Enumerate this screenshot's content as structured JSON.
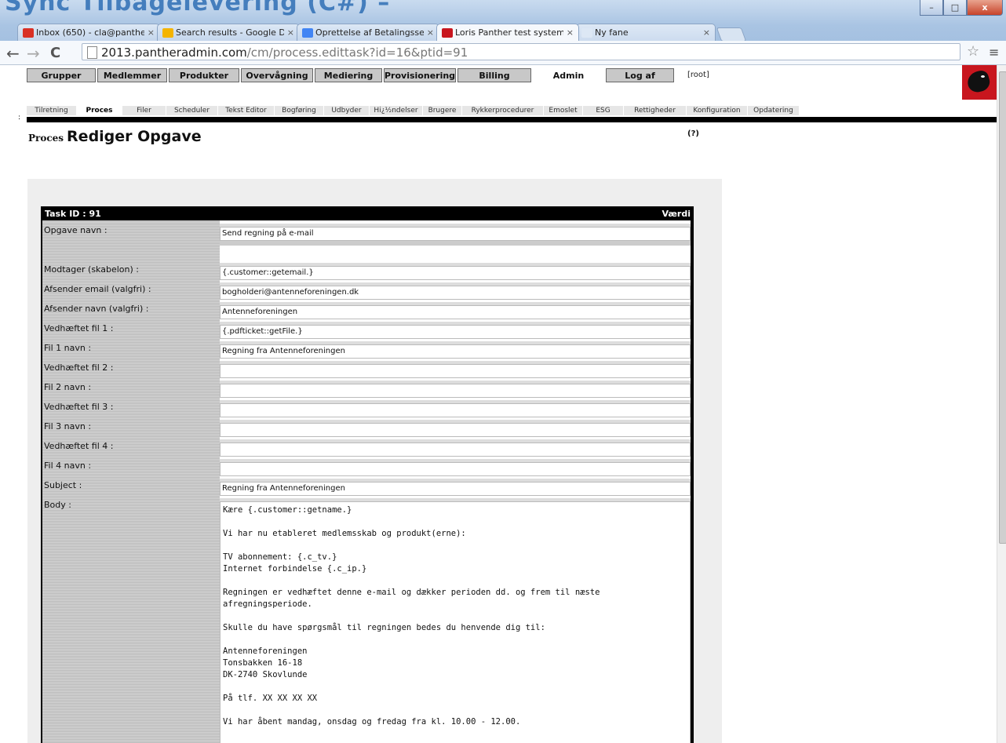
{
  "window": {
    "bg_title": "Sync Tilbagelevering (C#) –",
    "minimize": "–",
    "maximize": "□",
    "close": "x"
  },
  "tabs": [
    {
      "title": "Inbox (650) - cla@panther",
      "icon": "gmail-icon",
      "icon_color": "#d93025"
    },
    {
      "title": "Search results - Google Dr",
      "icon": "google-drive-icon",
      "icon_color": "#f4b400"
    },
    {
      "title": "Oprettelse af Betalingsser",
      "icon": "google-docs-icon",
      "icon_color": "#4285f4"
    },
    {
      "title": "Loris Panther test system",
      "icon": "panther-icon",
      "icon_color": "#c8161e"
    },
    {
      "title": "Ny fane",
      "icon": "",
      "icon_color": "#dde8f5"
    }
  ],
  "tab_close": "×",
  "toolbar": {
    "back": "←",
    "forward": "→",
    "reload": "C",
    "url_domain": "2013.pantheradmin.com",
    "url_path": "/cm/process.edittask?id=16&ptid=91",
    "star": "☆",
    "menu": "≡"
  },
  "nav": {
    "items": [
      "Grupper",
      "Medlemmer",
      "Produkter",
      "Overvågning",
      "Mediering",
      "Provisionering",
      "Billing",
      "Admin",
      "Log af"
    ],
    "active": "Admin",
    "user": "[root]"
  },
  "subnav": {
    "items": [
      "Tilretning",
      "Proces",
      "Filer",
      "Scheduler",
      "Tekst Editor",
      "Bogføring",
      "Udbyder",
      "Hi¿½ndelser",
      "Brugere",
      "Rykkerprocedurer",
      "Emoslet",
      "ESG",
      "Rettigheder",
      "Konfiguration",
      "Opdatering"
    ],
    "active": "Proces"
  },
  "heading": {
    "small": "Proces",
    "large": "Rediger Opgave",
    "help": "(?)",
    "left_mark": ":"
  },
  "form": {
    "task_id": "Task ID : 91",
    "value_header": "Værdi",
    "fields": [
      {
        "label": "Opgave navn :",
        "value": "Send regning på e-mail"
      },
      {
        "label": "Modtager (skabelon) :",
        "value": "{.customer::getemail.}"
      },
      {
        "label": "Afsender email (valgfri) :",
        "value": "bogholderi@antenneforeningen.dk"
      },
      {
        "label": "Afsender navn (valgfri) :",
        "value": "Antenneforeningen"
      },
      {
        "label": "Vedhæftet fil 1 :",
        "value": "{.pdfticket::getFile.}"
      },
      {
        "label": "Fil 1 navn :",
        "value": "Regning fra Antenneforeningen"
      },
      {
        "label": "Vedhæftet fil 2 :",
        "value": ""
      },
      {
        "label": "Fil 2 navn :",
        "value": ""
      },
      {
        "label": "Vedhæftet fil 3 :",
        "value": ""
      },
      {
        "label": "Fil 3 navn :",
        "value": ""
      },
      {
        "label": "Vedhæftet fil 4 :",
        "value": ""
      },
      {
        "label": "Fil 4 navn :",
        "value": ""
      },
      {
        "label": "Subject :",
        "value": "Regning fra Antenneforeningen"
      }
    ],
    "body_label": "Body :",
    "body_lines": [
      "Kære {.customer::getname.}",
      "",
      "Vi har nu etableret medlemsskab og produkt(erne):",
      "",
      "TV abonnement: {.c_tv.}",
      "Internet forbindelse {.c_ip.}",
      "",
      "Regningen er vedhæftet denne e-mail og dækker perioden dd. og frem til næste",
      "afregningsperiode.",
      "",
      "Skulle du have spørgsmål til regningen bedes du henvende dig til:",
      "",
      "Antenneforeningen",
      "Tonsbakken 16-18",
      "DK-2740 Skovlunde",
      "",
      "På tlf. XX XX XX XX",
      "",
      "Vi har åbent mandag, onsdag og fredag fra kl. 10.00 - 12.00."
    ]
  }
}
